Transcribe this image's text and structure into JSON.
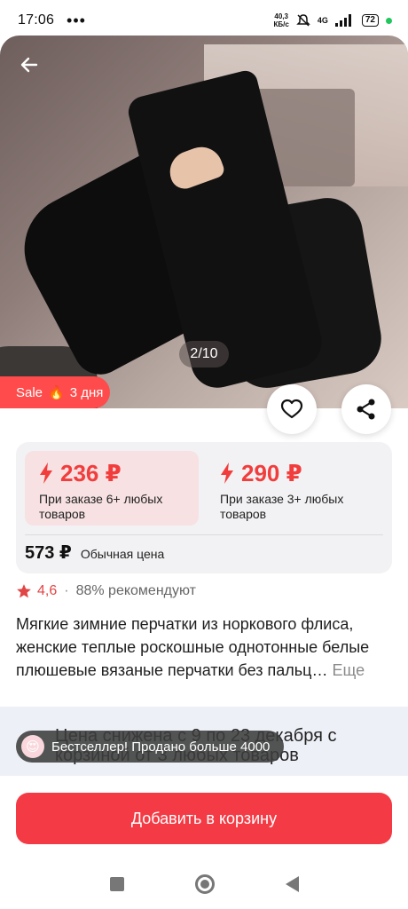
{
  "status_bar": {
    "time": "17:06",
    "dots": "•••",
    "net_speed_value": "40,3",
    "net_speed_unit": "КБ/с",
    "network": "4G",
    "battery": "72"
  },
  "gallery": {
    "counter": "2/10",
    "sale_label": "Sale",
    "sale_emoji": "🔥",
    "sale_days": "3 дня"
  },
  "prices": {
    "tier1": {
      "price": "236 ₽",
      "condition": "При заказе 6+ любых товаров"
    },
    "tier2": {
      "price": "290 ₽",
      "condition": "При заказе 3+ любых товаров"
    },
    "regular_price": "573 ₽",
    "regular_label": "Обычная цена",
    "accent_color": "#f23d3d"
  },
  "rating": {
    "score": "4,6",
    "separator": "·",
    "recommend": "88% рекомендуют"
  },
  "product": {
    "title": "Мягкие зимние перчатки из норкового флиса, женские теплые роскошные однотонные белые плюшевые вязаные перчатки без пальц…",
    "more": "Еще"
  },
  "promo": {
    "text": "Цена снижена с 9 по 23 декабря с корзиной от 3 любых товаров"
  },
  "bestseller": {
    "emoji": "😍",
    "label": "Бестселлер!",
    "detail": "Продано больше 4000"
  },
  "actions": {
    "add_to_cart": "Добавить в корзину"
  }
}
